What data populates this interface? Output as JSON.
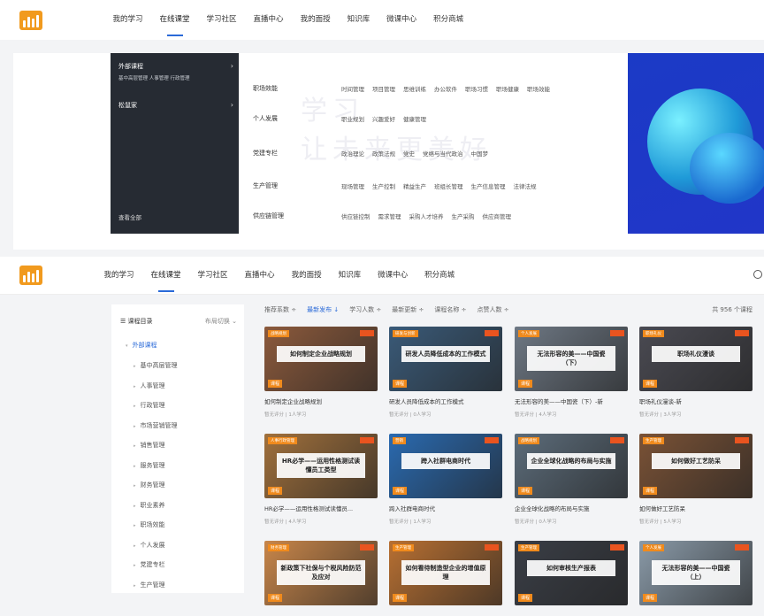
{
  "nav": {
    "items": [
      "我的学习",
      "在线课堂",
      "学习社区",
      "直播中心",
      "我的面授",
      "知识库",
      "微课中心",
      "积分商城"
    ],
    "active_index": 1
  },
  "banner": {
    "categories": [
      {
        "title": "外部课程",
        "sub": "基中高层管理  人事管理  行政管理"
      },
      {
        "title": "松鼠家",
        "sub": ""
      }
    ],
    "more": "查看全部",
    "watermark": [
      "学习",
      "让未来更美好"
    ],
    "rows": [
      {
        "head": "职场效能",
        "links": [
          "时间管理",
          "项目管理",
          "思维训练",
          "办公软件",
          "职场习惯",
          "职场健康",
          "职场效能"
        ]
      },
      {
        "head": "个人发展",
        "links": [
          "职业规划",
          "兴趣爱好",
          "健康管理"
        ]
      },
      {
        "head": "党建专栏",
        "links": [
          "政治理论",
          "政策法规",
          "党史",
          "党络与当代政治",
          "中国梦"
        ]
      },
      {
        "head": "生产管理",
        "links": [
          "现场管理",
          "生产控制",
          "精益生产",
          "班组长管理",
          "生产信息管理",
          "法律法规"
        ]
      },
      {
        "head": "供应链管理",
        "links": [
          "供应链控制",
          "需求管理",
          "采购人才培养",
          "生产采购",
          "供应商管理"
        ]
      }
    ]
  },
  "sidebar": {
    "heading": "☰ 课程目录",
    "switch": "布局切换 ⌄",
    "current": "外部课程",
    "items": [
      "基中高层管理",
      "人事管理",
      "行政管理",
      "市场营销管理",
      "销售管理",
      "服务管理",
      "财务管理",
      "职业素养",
      "职场效能",
      "个人发展",
      "党建专栏",
      "生产管理"
    ]
  },
  "filters": {
    "items": [
      "推荐系数 ÷",
      "最新发布 ↓",
      "学习人数 ÷",
      "最新更新 ÷",
      "课程名称 ÷",
      "点赞人数 ÷"
    ],
    "active_index": 1,
    "total": "共 956 个课程"
  },
  "courses": [
    {
      "thumb_title": "如何制定企业战略规划",
      "tag": "战略规划",
      "type": "课程",
      "name": "如何制定企业战略规划",
      "meta": "暂无评分 | 1人学习",
      "bg": "#8c5a3c"
    },
    {
      "thumb_title": "研发人员降低成本的工作模式",
      "tag": "研发与创新",
      "type": "课程",
      "name": "研发人员降低成本的工作模式",
      "meta": "暂无评分 | 0人学习",
      "bg": "#3a5a78"
    },
    {
      "thumb_title": "无法形容的美——中国瓷（下）",
      "tag": "个人发展",
      "type": "课程",
      "name": "无法形容的美——中国瓷（下）-新",
      "meta": "暂无评分 | 4人学习",
      "bg": "#6e7884"
    },
    {
      "thumb_title": "职场礼仪漫谈",
      "tag": "职场礼仪",
      "type": "课程",
      "name": "职场礼仪漫谈-新",
      "meta": "暂无评分 | 3人学习",
      "bg": "#4a4a52"
    },
    {
      "thumb_title": "HR必学——运用性格测试读懂员工类型",
      "tag": "人事行政管理",
      "type": "课程",
      "name": "HR必学——运用性格测试读懂员...",
      "meta": "暂无评分 | 4人学习",
      "bg": "#a0703c"
    },
    {
      "thumb_title": "跨入社群电商时代",
      "tag": "营销",
      "type": "课程",
      "name": "跨入社群电商时代",
      "meta": "暂无评分 | 1人学习",
      "bg": "#2a6ab0"
    },
    {
      "thumb_title": "企业全球化战略的布局与实施",
      "tag": "战略规划",
      "type": "课程",
      "name": "企业全球化战略的布局与实施",
      "meta": "暂无评分 | 0人学习",
      "bg": "#5c6c7a"
    },
    {
      "thumb_title": "如何做好工艺防呆",
      "tag": "生产管理",
      "type": "课程",
      "name": "如何做好工艺防呆",
      "meta": "暂无评分 | 5人学习",
      "bg": "#7a5236"
    },
    {
      "thumb_title": "新政策下社保与个税风险防范及应对",
      "tag": "财务管理",
      "type": "课程",
      "name": "",
      "meta": "",
      "bg": "#c8864a"
    },
    {
      "thumb_title": "如何看待制造型企业的增值原理",
      "tag": "生产管理",
      "type": "课程",
      "name": "",
      "meta": "",
      "bg": "#b87032"
    },
    {
      "thumb_title": "如何审核生产报表",
      "tag": "生产管理",
      "type": "课程",
      "name": "",
      "meta": "",
      "bg": "#3a3e46"
    },
    {
      "thumb_title": "无法形容的美——中国瓷（上）",
      "tag": "个人发展",
      "type": "课程",
      "name": "",
      "meta": "",
      "bg": "#8a9aa8"
    }
  ]
}
